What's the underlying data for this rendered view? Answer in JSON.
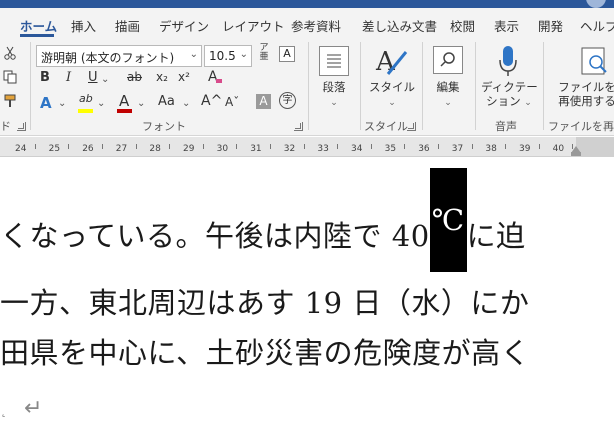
{
  "tabs": [
    {
      "label": "ホーム",
      "active": true
    },
    {
      "label": "挿入"
    },
    {
      "label": "描画"
    },
    {
      "label": "デザイン"
    },
    {
      "label": "レイアウト"
    },
    {
      "label": "参考資料"
    },
    {
      "label": "差し込み文書"
    },
    {
      "label": "校閲"
    },
    {
      "label": "表示"
    },
    {
      "label": "開発"
    },
    {
      "label": "ヘルプ"
    }
  ],
  "font": {
    "name": "游明朝 (本文のフォント)",
    "size": "10.5",
    "bold": "B",
    "italic": "I",
    "underline": "U",
    "strike": "ab",
    "subscript": "x₂",
    "superscript": "x²",
    "clear": "A",
    "text_effect": "A",
    "highlight": "ab",
    "font_color": "A",
    "case": "Aa",
    "grow": "A^",
    "shrink": "Aˇ",
    "shading": "A",
    "enclose": "字",
    "group_label": "フォント"
  },
  "clipboard": {
    "group_label": "ド"
  },
  "paragraph": {
    "label": "段落"
  },
  "styles": {
    "label": "スタイル",
    "group_label": "スタイル"
  },
  "editing": {
    "label": "編集"
  },
  "voice": {
    "label": "ディクテー\nション",
    "label_line1": "ディクテー",
    "label_line2": "ション",
    "group_label": "音声"
  },
  "reuse": {
    "label_line1": "ファイルを",
    "label_line2": "再使用する",
    "group_label": "ファイルを再使用"
  },
  "ruler": {
    "ticks": [
      "24",
      "25",
      "26",
      "27",
      "28",
      "29",
      "30",
      "31",
      "32",
      "33",
      "34",
      "35",
      "36",
      "37",
      "38",
      "39",
      "40",
      "41"
    ]
  },
  "document": {
    "line1_before": "くなっている。午後は内陸で 40",
    "line1_selected": "℃",
    "line1_after": "に迫",
    "line2": "一方、東北周辺はあす 19 日（水）にか",
    "line3": "田県を中心に、土砂災害の危険度が高く",
    "paragraph_mark": "↵"
  },
  "colors": {
    "accent": "#2b579a",
    "highlight": "#ffff00",
    "font_color": "#c00000"
  }
}
